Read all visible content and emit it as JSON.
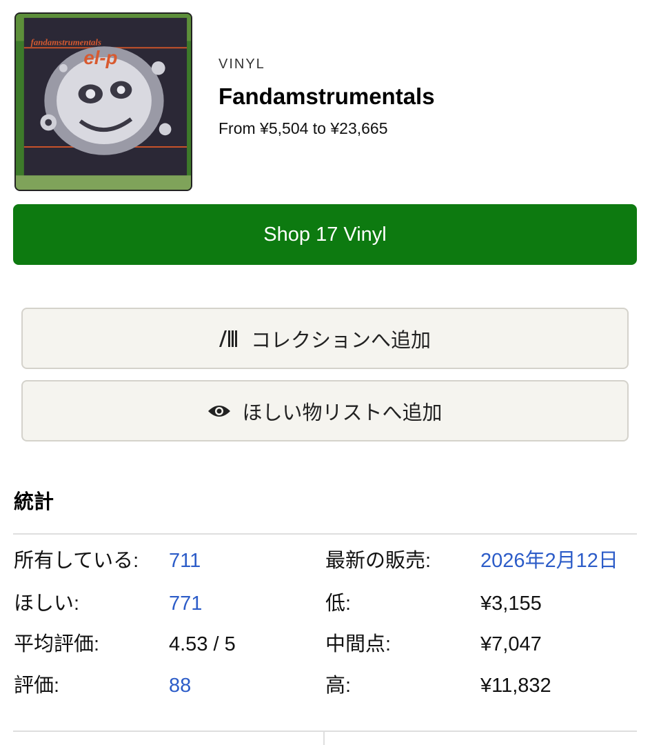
{
  "release": {
    "format": "VINYL",
    "title": "Fandamstrumentals",
    "price_range": "From ¥5,504 to ¥23,665",
    "cover_text_1": "fandamstrumentals",
    "cover_text_2": "el-p"
  },
  "shop": {
    "label": "Shop 17 Vinyl"
  },
  "actions": {
    "collection_label": "コレクションへ追加",
    "wantlist_label": "ほしい物リストへ追加"
  },
  "stats": {
    "heading": "統計",
    "have_label": "所有している:",
    "have_value": "711",
    "want_label": "ほしい:",
    "want_value": "771",
    "avg_rating_label": "平均評価:",
    "avg_rating_value": "4.53 / 5",
    "ratings_label": "評価:",
    "ratings_value": "88",
    "last_sold_label": "最新の販売:",
    "last_sold_value": "2026年2月12日",
    "low_label": "低:",
    "low_value": "¥3,155",
    "median_label": "中間点:",
    "median_value": "¥7,047",
    "high_label": "高:",
    "high_value": "¥11,832"
  },
  "colors": {
    "shop_green": "#0d7a10",
    "link_blue": "#2c5cc8",
    "button_bg": "#f5f4ef"
  },
  "icons": {
    "collection": "vinyl-collection-icon",
    "wantlist": "eye-icon"
  }
}
